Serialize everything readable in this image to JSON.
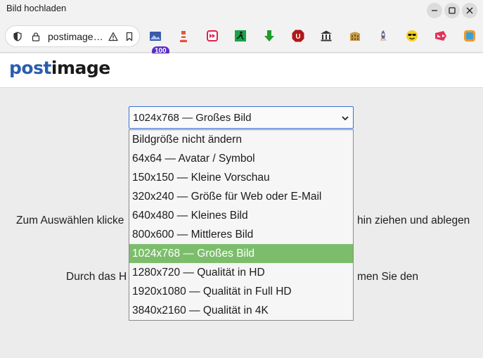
{
  "window": {
    "title": "Bild hochladen"
  },
  "urlbar": {
    "url": "postimage…"
  },
  "extensions": {
    "badge_count": "100"
  },
  "site": {
    "logo_part1": "post",
    "logo_part2": "image"
  },
  "form": {
    "selected_size": "1024x768 — Großes Bild",
    "options": [
      "Bildgröße nicht ändern",
      "64x64 — Avatar / Symbol",
      "150x150 — Kleine Vorschau",
      "320x240 — Größe für Web oder E-Mail",
      "640x480 — Kleines Bild",
      "800x600 — Mittleres Bild",
      "1024x768 — Großes Bild",
      "1280x720 — Qualität in HD",
      "1920x1080 — Qualität in Full HD",
      "3840x2160 — Qualität in 4K"
    ],
    "selected_index": 6
  },
  "background_text": {
    "line1_left": "Zum Auswählen klicke",
    "line1_right": "hin ziehen und ablegen",
    "line2_left": "Durch das H",
    "line2_right": "men Sie den"
  }
}
